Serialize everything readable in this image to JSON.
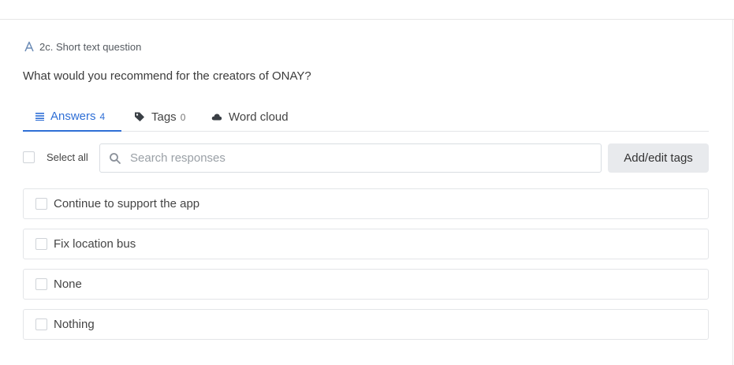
{
  "question": {
    "type_label": "2c. Short text question",
    "type_icon": "text-a-icon",
    "text": "What would you recommend for the creators of ONAY?"
  },
  "tabs": [
    {
      "label": "Answers",
      "count": "4",
      "icon": "list-icon",
      "active": true
    },
    {
      "label": "Tags",
      "count": "0",
      "icon": "tag-icon",
      "active": false
    },
    {
      "label": "Word cloud",
      "count": "",
      "icon": "cloud-icon",
      "active": false
    }
  ],
  "toolbar": {
    "select_all_label": "Select all",
    "search_placeholder": "Search responses",
    "add_tags_label": "Add/edit tags"
  },
  "answers": [
    {
      "text": "Continue to support the app"
    },
    {
      "text": "Fix location bus"
    },
    {
      "text": "None"
    },
    {
      "text": "Nothing"
    }
  ],
  "colors": {
    "accent": "#2f6fd6",
    "border": "#e3e5e8",
    "button_bg": "#e8eaed"
  }
}
